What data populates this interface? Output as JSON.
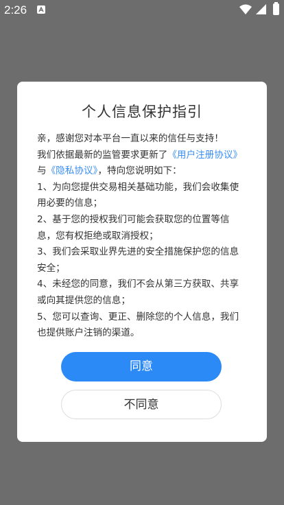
{
  "status_bar": {
    "time": "2:26",
    "notification_icon": "app-notification-icon",
    "wifi_icon": "wifi-icon",
    "signal_icon": "cell-signal-icon",
    "battery_icon": "battery-charging-icon"
  },
  "dialog": {
    "title": "个人信息保护指引",
    "intro": "亲，感谢您对本平台一直以来的信任与支持！",
    "line2_prefix": "我们依据最新的监管要求更新了",
    "user_agreement_link": "《用户注册协议》",
    "line3_prefix": "与",
    "privacy_link": "《隐私协议》",
    "line3_suffix": "，特向您说明如下：",
    "items": [
      "1、为向您提供交易相关基础功能，我们会收集使用必要的信息；",
      "2、基于您的授权我们可能会获取您的位置等信息，您有权拒绝或取消授权；",
      "3、我们会采取业界先进的安全措施保护您的信息安全；",
      "4、未经您的同意，我们不会从第三方获取、共享或向其提供您的信息；",
      "5、您可以查询、更正、删除您的个人信息，我们也提供账户注销的渠道。"
    ],
    "agree_label": "同意",
    "disagree_label": "不同意"
  },
  "colors": {
    "overlay": "#6d6d6d",
    "link": "#3a8ef5",
    "primary_button": "#2b8af5"
  }
}
